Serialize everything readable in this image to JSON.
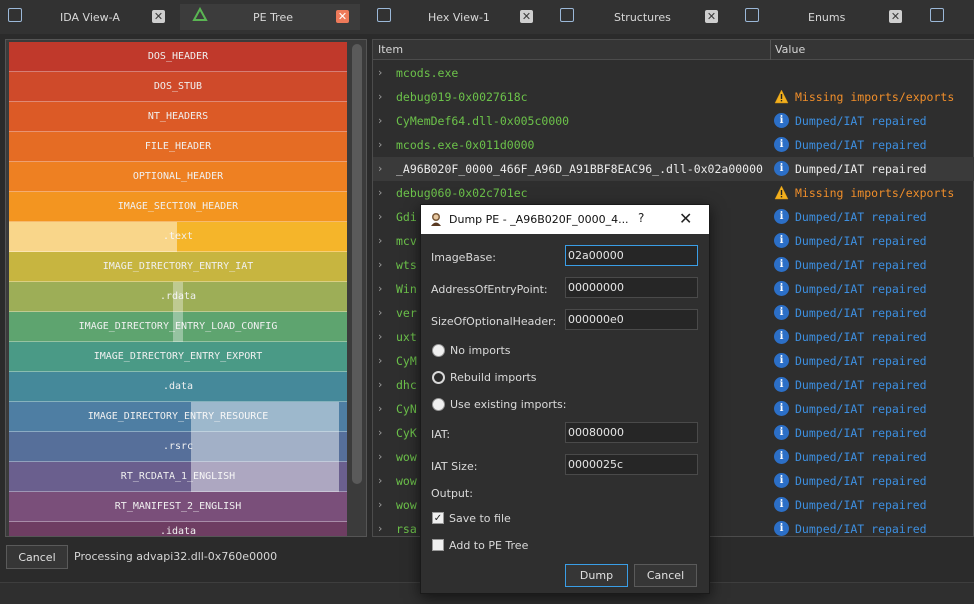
{
  "tabs": [
    {
      "label": "IDA View-A",
      "active": false,
      "icon": "ida-view-icon"
    },
    {
      "label": "PE Tree",
      "active": true,
      "icon": "pe-tree-icon"
    },
    {
      "label": "Hex View-1",
      "active": false,
      "icon": "hex-view-icon"
    },
    {
      "label": "Structures",
      "active": false,
      "icon": "structures-icon"
    },
    {
      "label": "Enums",
      "active": false,
      "icon": "enums-icon"
    }
  ],
  "pe_map": {
    "blocks": [
      {
        "label": "DOS_HEADER",
        "color": "#c0392b"
      },
      {
        "label": "DOS_STUB",
        "color": "#cf4a2a"
      },
      {
        "label": "NT_HEADERS",
        "color": "#dc5a26"
      },
      {
        "label": "FILE_HEADER",
        "color": "#e56c24"
      },
      {
        "label": "OPTIONAL_HEADER",
        "color": "#ee8022"
      },
      {
        "label": "IMAGE_SECTION_HEADER",
        "color": "#f39520"
      },
      {
        "label": ".text",
        "color": "#f5b52a"
      },
      {
        "label": "IMAGE_DIRECTORY_ENTRY_IAT",
        "color": "#c7b540"
      },
      {
        "label": ".rdata",
        "color": "#9dae57"
      },
      {
        "label": "IMAGE_DIRECTORY_ENTRY_LOAD_CONFIG",
        "color": "#5ea46f"
      },
      {
        "label": "IMAGE_DIRECTORY_ENTRY_EXPORT",
        "color": "#4a9a86"
      },
      {
        "label": ".data",
        "color": "#45899a"
      },
      {
        "label": "IMAGE_DIRECTORY_ENTRY_RESOURCE",
        "color": "#4e7ea3"
      },
      {
        "label": ".rsrc",
        "color": "#566f9a"
      },
      {
        "label": "RT_RCDATA_1_ENGLISH",
        "color": "#6a5f8e"
      },
      {
        "label": "RT_MANIFEST_2_ENGLISH",
        "color": "#7a4f7a"
      },
      {
        "label": ".idata",
        "color": "#6e3d62"
      }
    ]
  },
  "tree": {
    "col_item": "Item",
    "col_value": "Value",
    "rows": [
      {
        "name": "mcods.exe",
        "status": "",
        "kind": "none"
      },
      {
        "name": "debug019-0x0027618c",
        "status": "Missing imports/exports",
        "kind": "warn"
      },
      {
        "name": "CyMemDef64.dll-0x005c0000",
        "status": "Dumped/IAT repaired",
        "kind": "ok"
      },
      {
        "name": "mcods.exe-0x011d0000",
        "status": "Dumped/IAT repaired",
        "kind": "ok"
      },
      {
        "name": "_A96B020F_0000_466F_A96D_A91BBF8EAC96_.dll-0x02a00000",
        "status": "Dumped/IAT repaired",
        "kind": "ok",
        "selected": true
      },
      {
        "name": "debug060-0x02c701ec",
        "status": "Missing imports/exports",
        "kind": "warn"
      },
      {
        "name": "Gdi",
        "status": "Dumped/IAT repaired",
        "kind": "ok"
      },
      {
        "name": "mcv",
        "status": "Dumped/IAT repaired",
        "kind": "ok"
      },
      {
        "name": "wts",
        "status": "Dumped/IAT repaired",
        "kind": "ok"
      },
      {
        "name": "Win",
        "status": "Dumped/IAT repaired",
        "kind": "ok"
      },
      {
        "name": "ver",
        "status": "Dumped/IAT repaired",
        "kind": "ok"
      },
      {
        "name": "uxt",
        "status": "Dumped/IAT repaired",
        "kind": "ok"
      },
      {
        "name": "CyM",
        "status": "Dumped/IAT repaired",
        "kind": "ok"
      },
      {
        "name": "dhc",
        "status": "Dumped/IAT repaired",
        "kind": "ok"
      },
      {
        "name": "CyN",
        "status": "Dumped/IAT repaired",
        "kind": "ok"
      },
      {
        "name": "CyK",
        "status": "Dumped/IAT repaired",
        "kind": "ok"
      },
      {
        "name": "wow",
        "status": "Dumped/IAT repaired",
        "kind": "ok"
      },
      {
        "name": "wow",
        "status": "Dumped/IAT repaired",
        "kind": "ok"
      },
      {
        "name": "wow",
        "status": "Dumped/IAT repaired",
        "kind": "ok"
      },
      {
        "name": "rsa",
        "status": "Dumped/IAT repaired",
        "kind": "ok"
      }
    ]
  },
  "bottom": {
    "cancel_label": "Cancel",
    "processing": "Processing advapi32.dll-0x760e0000"
  },
  "dialog": {
    "title": "Dump PE - _A96B020F_0000_4...",
    "help": "?",
    "close": "✕",
    "fields": {
      "image_base_label": "ImageBase:",
      "image_base_value": "02a00000",
      "entry_point_label": "AddressOfEntryPoint:",
      "entry_point_value": "00000000",
      "size_opt_header_label": "SizeOfOptionalHeader:",
      "size_opt_header_value": "000000e0",
      "iat_label": "IAT:",
      "iat_value": "00080000",
      "iat_size_label": "IAT Size:",
      "iat_size_value": "0000025c"
    },
    "import_options": {
      "no_imports": "No imports",
      "rebuild_imports": "Rebuild imports",
      "use_existing": "Use existing imports:",
      "selected": "rebuild_imports"
    },
    "output": {
      "label": "Output:",
      "save_to_file": "Save to file",
      "save_to_file_checked": true,
      "add_to_pe_tree": "Add to PE Tree",
      "add_to_pe_tree_checked": false
    },
    "dump_label": "Dump",
    "cancel_label": "Cancel"
  }
}
